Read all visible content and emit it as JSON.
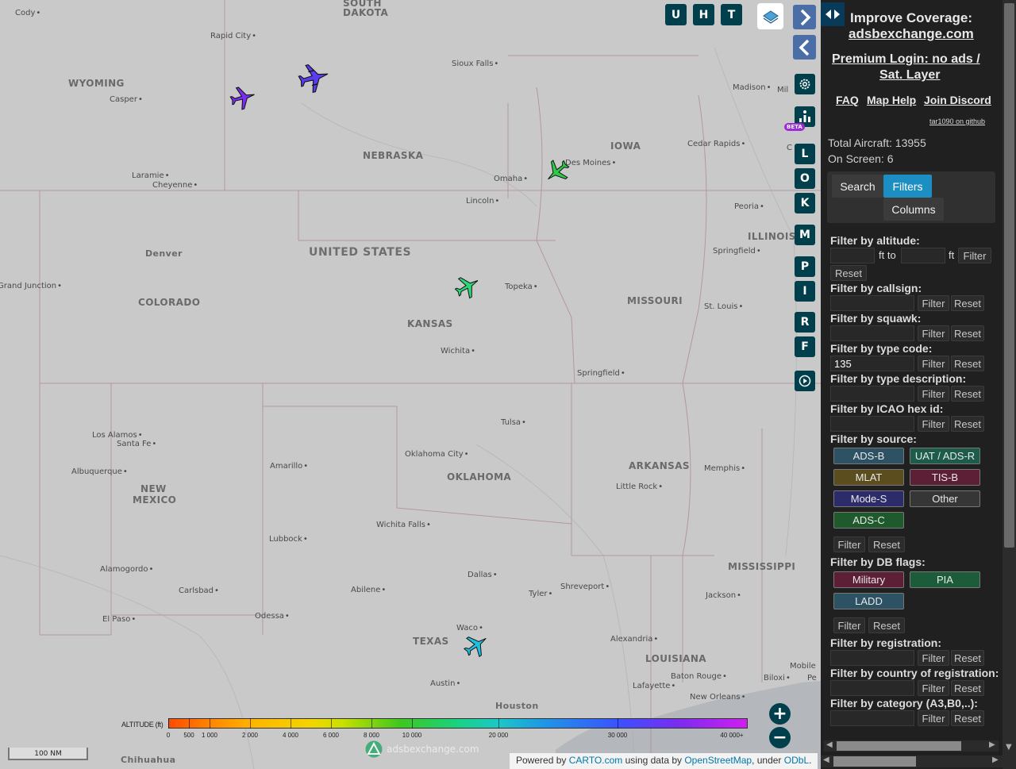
{
  "toolbar": {
    "u": "U",
    "h": "H",
    "t": "T"
  },
  "side_buttons": [
    "L",
    "O",
    "K",
    "M",
    "P",
    "I",
    "R",
    "F"
  ],
  "beta": "BETA",
  "map_labels": {
    "countries": [
      "UNITED STATES"
    ],
    "states": [
      "WYOMING",
      "NEBRASKA",
      "IOWA",
      "COLORADO",
      "KANSAS",
      "MISSOURI",
      "ILLINOIS",
      "NEW MEXICO",
      "OKLAHOMA",
      "ARKANSAS",
      "MISSISSIPPI",
      "TEXAS",
      "LOUISIANA",
      "SOUTH DAKOTA"
    ],
    "cities": [
      "Cody",
      "Rapid City",
      "Sioux Falls",
      "Casper",
      "Madison",
      "Cedar Rapids",
      "Des Moines",
      "Omaha",
      "Lincoln",
      "Laramie",
      "Cheyenne",
      "Peoria",
      "Springfield",
      "Denver",
      "Grand Junction",
      "Topeka",
      "St. Louis",
      "Wichita",
      "Springfield",
      "Tulsa",
      "Los Alamos",
      "Santa Fe",
      "Oklahoma City",
      "Amarillo",
      "Albuquerque",
      "Memphis",
      "Little Rock",
      "Wichita Falls",
      "Lubbock",
      "Alamogordo",
      "Dallas",
      "Carlsbad",
      "Abilene",
      "Tyler",
      "Shreveport",
      "Jackson",
      "El Paso",
      "Odessa",
      "Waco",
      "Alexandria",
      "Mobile",
      "Biloxi",
      "Baton Rouge",
      "Lafayette",
      "New Orleans",
      "Austin",
      "Houston",
      "Chihuahua"
    ],
    "edge_fragments": [
      "Mil",
      "C",
      "Pe"
    ]
  },
  "altitude_legend": {
    "title": "ALTITUDE (ft)",
    "ticks": [
      "0",
      "500",
      "1 000",
      "2 000",
      "4 000",
      "6 000",
      "8 000",
      "10 000",
      "20 000",
      "30 000",
      "40 000+"
    ]
  },
  "scale_bar": "100 NM",
  "watermark": "adsbexchange.com",
  "attribution": {
    "prefix": "Powered by ",
    "carto": "CARTO.com",
    "middle": " using data by ",
    "osm": "OpenStreetMap",
    "under": ", under ",
    "odbl": "ODbL",
    "end": "."
  },
  "sidebar": {
    "improve_line1": "Improve Coverage:",
    "improve_line2": "adsbexchange.com",
    "premium_line1": "Premium Login: no ads /",
    "premium_line2": "Sat. Layer",
    "faq": "FAQ",
    "map_help": "Map Help",
    "join_discord": "Join Discord",
    "github": "tar1090 on github",
    "total_aircraft": "Total Aircraft: 13955",
    "on_screen": "On Screen: 6",
    "tabs": {
      "search": "Search",
      "filters": "Filters",
      "columns": "Columns"
    },
    "filters": {
      "altitude_label": "Filter by altitude:",
      "ft_to": "ft to",
      "ft": "ft",
      "callsign_label": "Filter by callsign:",
      "squawk_label": "Filter by squawk:",
      "type_code_label": "Filter by type code:",
      "type_code_value": "135",
      "type_desc_label": "Filter by type description:",
      "icao_label": "Filter by ICAO hex id:",
      "source_label": "Filter by source:",
      "sources": [
        "ADS-B",
        "UAT / ADS-R",
        "MLAT",
        "TIS-B",
        "Mode-S",
        "Other",
        "ADS-C"
      ],
      "db_flags_label": "Filter by DB flags:",
      "db_flags": [
        "Military",
        "PIA",
        "LADD"
      ],
      "registration_label": "Filter by registration:",
      "country_label": "Filter by country of registration:",
      "category_label": "Filter by category (A3,B0,..):",
      "filter_btn": "Filter",
      "reset_btn": "Reset"
    }
  }
}
